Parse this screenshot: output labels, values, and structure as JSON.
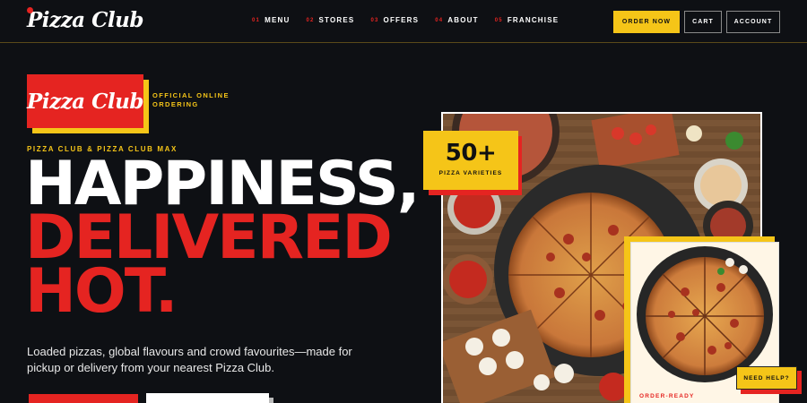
{
  "brand": {
    "name": "Pizza Club",
    "accent": "#e52421",
    "yellow": "#f5c518"
  },
  "nav": [
    {
      "num": "01",
      "label": "MENU"
    },
    {
      "num": "02",
      "label": "STORES"
    },
    {
      "num": "03",
      "label": "OFFERS"
    },
    {
      "num": "04",
      "label": "ABOUT"
    },
    {
      "num": "05",
      "label": "FRANCHISE"
    }
  ],
  "header_buttons": {
    "order": "ORDER NOW",
    "cart": "CART",
    "account": "ACCOUNT"
  },
  "hero": {
    "badge_logo": "Pizza Club",
    "official": "OFFICIAL ONLINE ORDERING",
    "eyebrow": "PIZZA CLUB & PIZZA CLUB MAX",
    "line1": "HAPPINESS,",
    "line2": "DELIVERED",
    "line3": "HOT.",
    "description": "Loaded pizzas, global flavours and crowd favourites—made for pickup or delivery from your nearest Pizza Club."
  },
  "stat": {
    "value": "50+",
    "label": "PIZZA VARIETIES"
  },
  "card": {
    "label": "ORDER-READY"
  },
  "help": {
    "label": "NEED HELP?"
  }
}
